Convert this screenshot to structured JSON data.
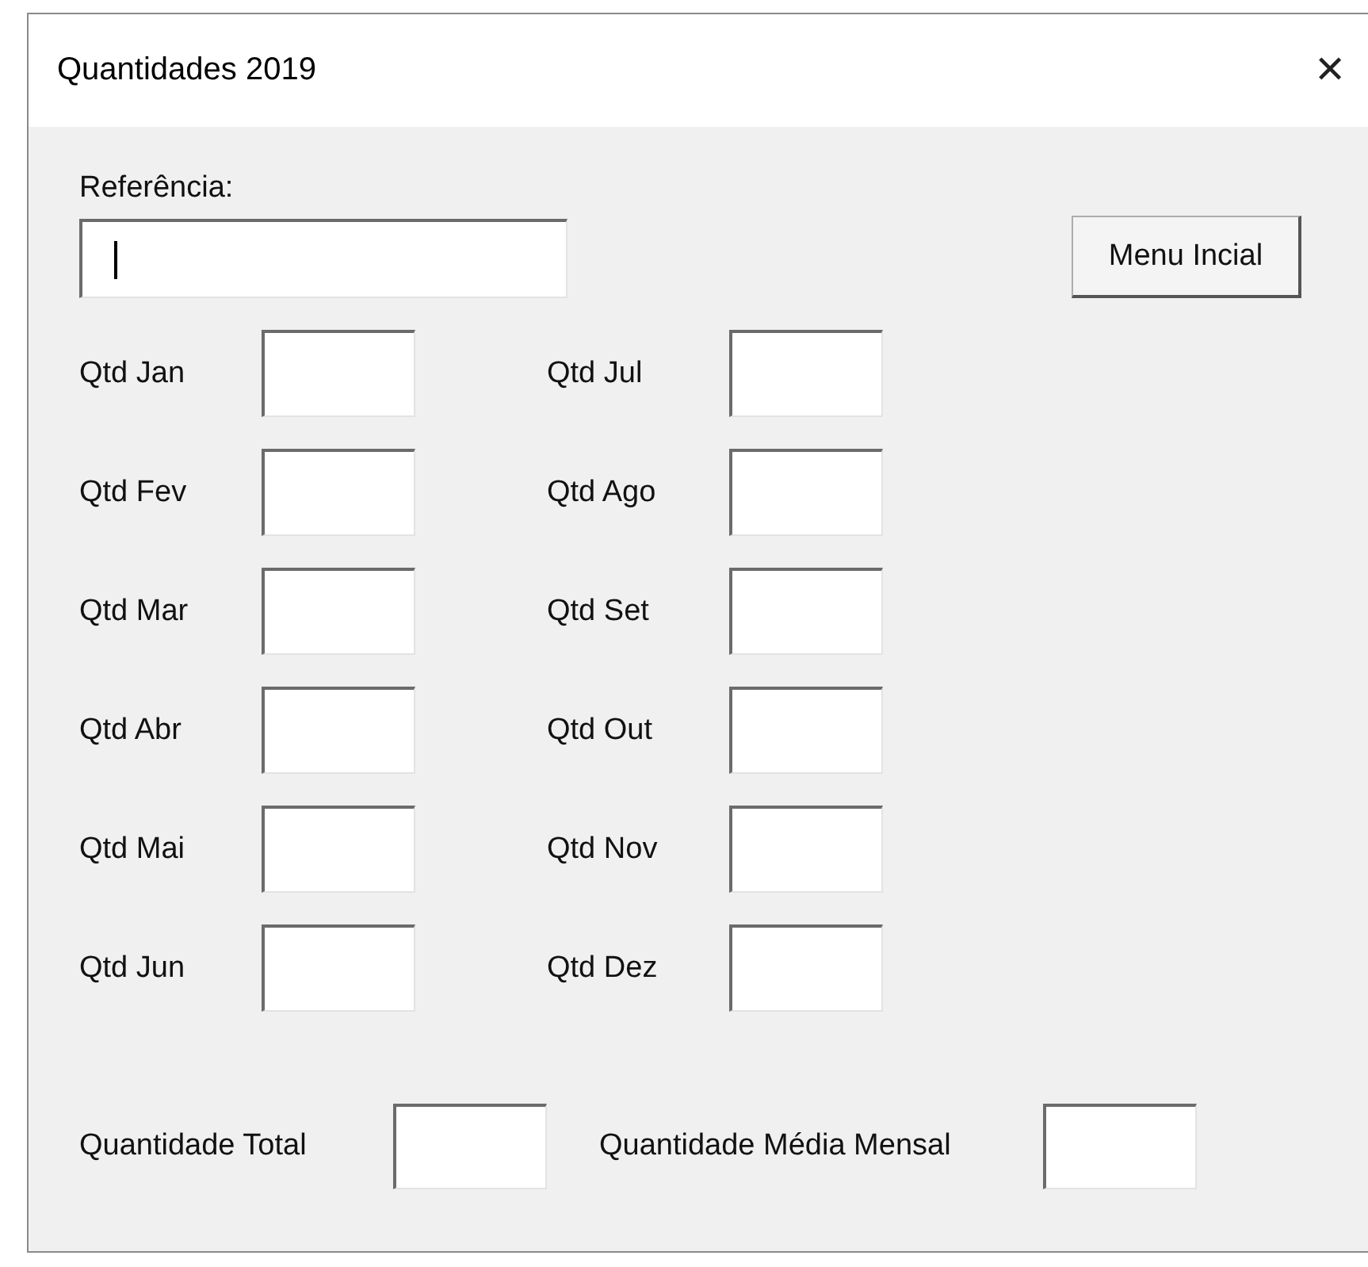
{
  "window": {
    "title": "Quantidades 2019",
    "close": "✕"
  },
  "reference": {
    "label": "Referência:",
    "focused": true
  },
  "menu_button": "Menu Incial",
  "months_left": [
    {
      "label": "Qtd Jan"
    },
    {
      "label": "Qtd Fev"
    },
    {
      "label": "Qtd Mar"
    },
    {
      "label": "Qtd Abr"
    },
    {
      "label": "Qtd Mai"
    },
    {
      "label": "Qtd Jun"
    }
  ],
  "months_right": [
    {
      "label": "Qtd Jul"
    },
    {
      "label": "Qtd Ago"
    },
    {
      "label": "Qtd Set"
    },
    {
      "label": "Qtd Out"
    },
    {
      "label": "Qtd Nov"
    },
    {
      "label": "Qtd Dez"
    }
  ],
  "totals": [
    {
      "label": "Quantidade Total"
    },
    {
      "label": "Quantidade Média Mensal"
    }
  ]
}
